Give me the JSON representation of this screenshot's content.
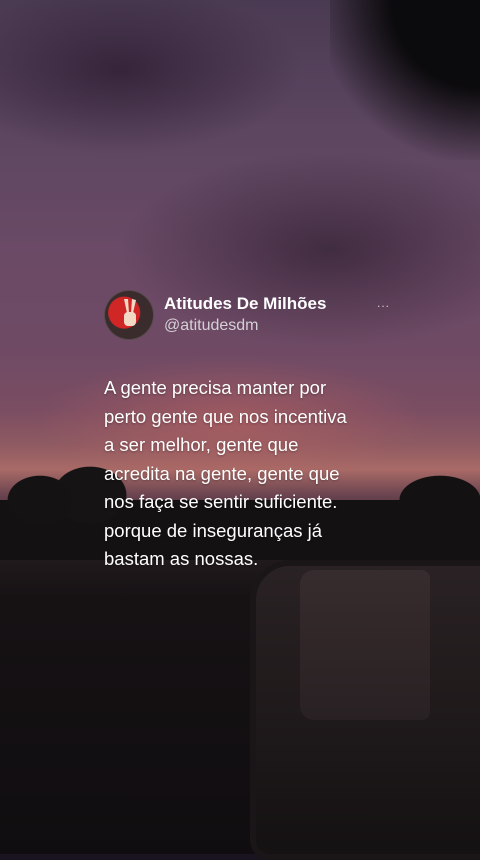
{
  "post": {
    "author_name": "Atitudes De Milhões",
    "handle": "@atitudesdm",
    "more_label": "...",
    "lines": [
      "A gente precisa manter por",
      "perto gente que nos incentiva",
      "a ser melhor, gente que",
      "acredita na gente, gente que",
      "nos faça se sentir suficiente.",
      "porque de inseguranças já",
      "bastam as nossas."
    ]
  }
}
